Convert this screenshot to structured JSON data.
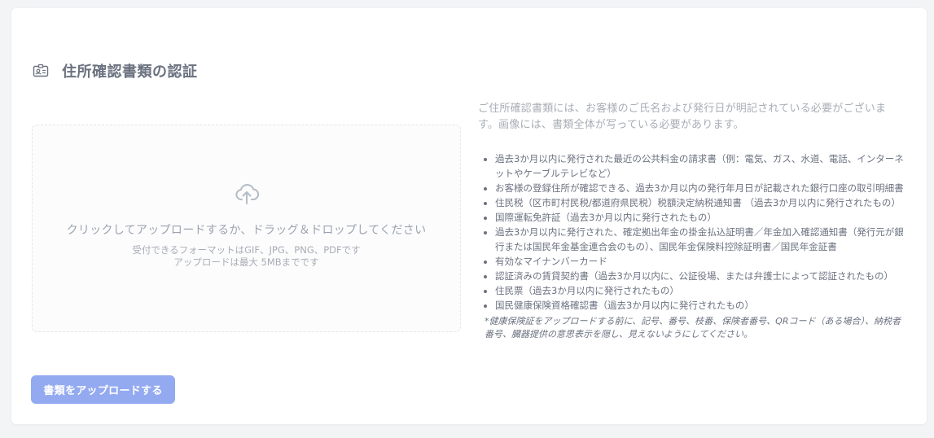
{
  "section": {
    "title": "住所確認書類の認証",
    "icon": "id-card-icon"
  },
  "dropzone": {
    "icon": "cloud-upload-icon",
    "instruction": "クリックしてアップロードするか、ドラッグ＆ドロップしてください",
    "formats": "受付できるフォーマットはGIF、JPG、PNG、PDFです",
    "max_size": "アップロードは最大 5MBまでです"
  },
  "requirements": {
    "intro": "ご住所確認書類には、お客様のご氏名および発行日が明記されている必要がございます。画像には、書類全体が写っている必要があります。",
    "items": [
      "過去3か月以内に発行された最近の公共料金の請求書（例：電気、ガス、水道、電話、インターネットやケーブルテレビなど）",
      "お客様の登録住所が確認できる、過去3か月以内の発行年月日が記載された銀行口座の取引明細書",
      "住民税（区市町村民税/都道府県民税）税額決定納税通知書 （過去3か月以内に発行されたもの）",
      "国際運転免許証（過去3か月以内に発行されたもの）",
      "過去3か月以内に発行された、確定拠出年金の掛金払込証明書／年金加入確認通知書（発行元が銀行または国民年金基金連合会のもの）、国民年金保険料控除証明書／国民年金証書",
      "有効なマイナンバーカード",
      "認証済みの賃貸契約書（過去3か月以内に、公証役場、または弁護士によって認証されたもの）",
      "住民票（過去3か月以内に発行されたもの）",
      "国民健康保険資格確認書（過去3か月以内に発行されたもの）"
    ],
    "note": "*健康保険証をアップロードする前に、記号、番号、枝番、保険者番号、QRコード（ある場合）、納税者番号、臓器提供の意思表示を隠し、見えないようにしてください。"
  },
  "actions": {
    "upload_label": "書類をアップロードする"
  },
  "colors": {
    "button_bg": "#93aaf0",
    "card_bg": "#ffffff",
    "page_bg": "#f3f4f6"
  }
}
